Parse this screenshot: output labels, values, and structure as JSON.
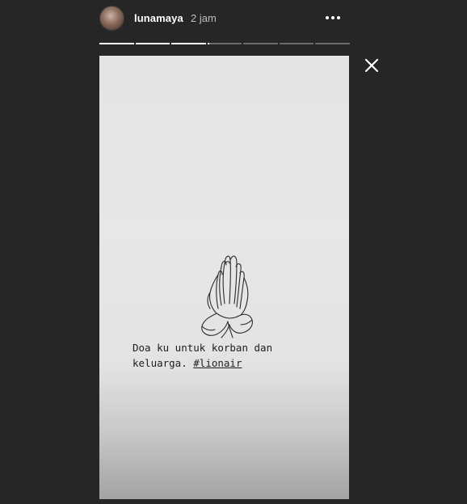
{
  "header": {
    "username": "lunamaya",
    "timestamp": "2 jam",
    "more_icon": "more-horizontal-icon"
  },
  "progress": {
    "segments": 7,
    "current_index": 3,
    "current_fraction": 0.05
  },
  "close_icon": "close-icon",
  "story": {
    "illustration_icon": "praying-hands-icon",
    "caption_line1": "Doa ku untuk korban dan",
    "caption_line2_text": "keluarga. ",
    "caption_hashtag": "#lionair"
  },
  "colors": {
    "background": "#262626",
    "text_primary": "#ffffff",
    "text_secondary": "#bdbdbd",
    "progress_inactive": "#6b6b6b",
    "progress_active": "#ffffff"
  }
}
